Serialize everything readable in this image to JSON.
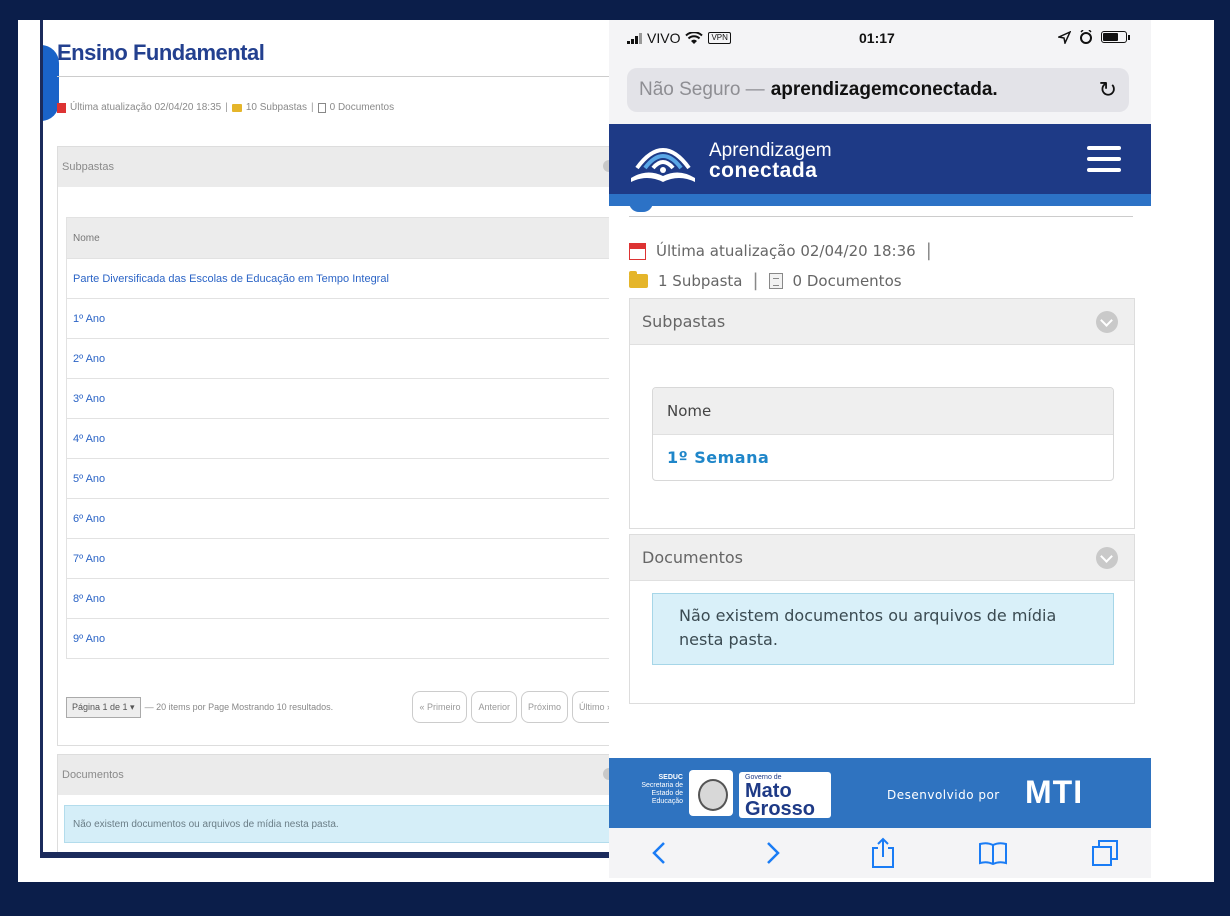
{
  "left": {
    "title": "Ensino Fundamental",
    "meta_updated": "Última atualização 02/04/20 18:35",
    "meta_folders": "10 Subpastas",
    "meta_docs": "0 Documentos",
    "subpastas_title": "Subpastas",
    "table_header": "Nome",
    "rows": [
      "Parte Diversificada das Escolas de Educação em Tempo Integral",
      "1º Ano",
      "2º Ano",
      "3º Ano",
      "4º Ano",
      "5º Ano",
      "6º Ano",
      "7º Ano",
      "8º Ano",
      "9º Ano"
    ],
    "pager_select": "Página 1 de 1 ▾",
    "pager_info": "— 20 items por Page Mostrando 10 resultados.",
    "pager_buttons": [
      "« Primeiro",
      "Anterior",
      "Próximo",
      "Último »"
    ],
    "documentos_title": "Documentos",
    "alert_text": "Não existem documentos ou arquivos de mídia nesta pasta."
  },
  "phone": {
    "status": {
      "carrier": "VIVO",
      "vpn": "VPN",
      "time": "01:17"
    },
    "address": {
      "prefix": "Não Seguro —",
      "domain": "aprendizagemconectada.",
      "reload": "↻"
    },
    "logo": {
      "line1": "Aprendizagem",
      "line2": "conectada"
    },
    "meta": {
      "updated": "Última atualização 02/04/20 18:36",
      "folders": "1 Subpasta",
      "docs": "0 Documentos"
    },
    "subpastas": {
      "title": "Subpastas",
      "header": "Nome",
      "rows": [
        "1º Semana"
      ]
    },
    "documentos": {
      "title": "Documentos",
      "alert": "Não existem documentos ou arquivos de mídia nesta pasta."
    },
    "footer": {
      "seduc": [
        "SEDUC",
        "Secretaria de",
        "Estado de",
        "Educação"
      ],
      "gov_small": "Governo de",
      "gov_line1": "Mato",
      "gov_line2": "Grosso",
      "developed_by": "Desenvolvido por",
      "mti": "MTI"
    }
  },
  "colors": {
    "brand_navy": "#1e3a86",
    "brand_blue": "#2f73c0",
    "link": "#1f86c9",
    "alert_bg": "#d9f0f9"
  }
}
